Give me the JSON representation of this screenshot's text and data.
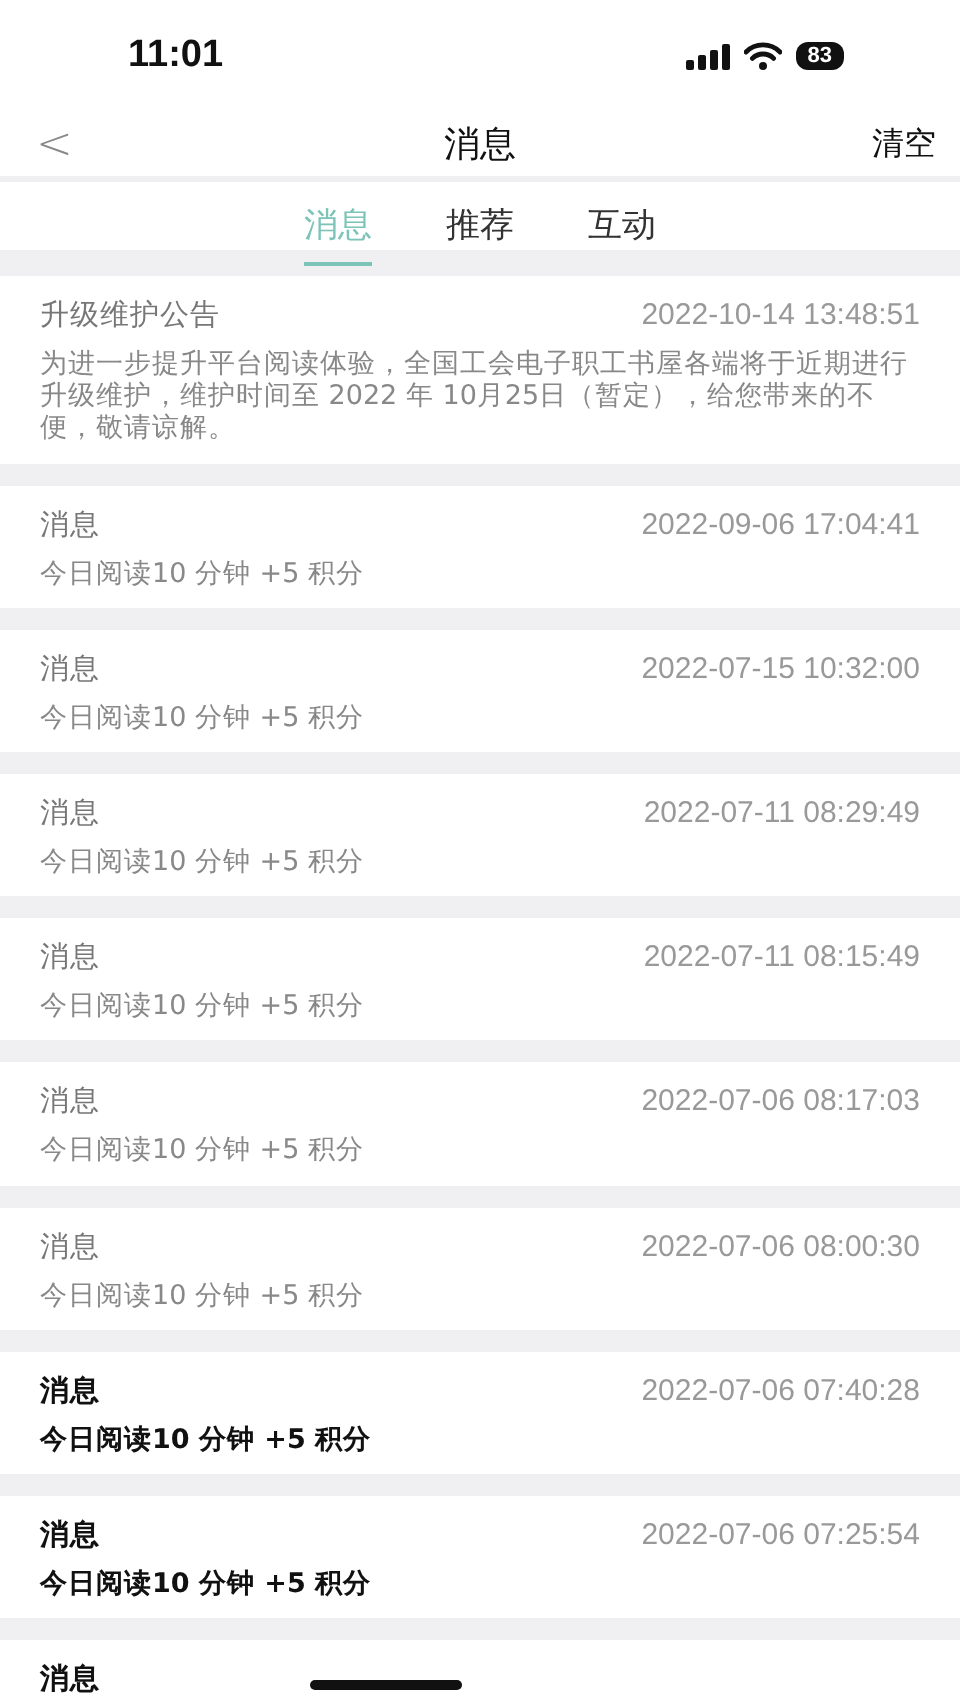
{
  "status_bar": {
    "time": "11:01",
    "battery": "83"
  },
  "nav": {
    "back": "<",
    "title": "消息",
    "action": "清空"
  },
  "tabs": [
    {
      "label": "消息",
      "selected": true
    },
    {
      "label": "推荐",
      "selected": false
    },
    {
      "label": "互动",
      "selected": false
    }
  ],
  "messages": [
    {
      "title": "升级维护公告",
      "time": "2022-10-14 13:48:51",
      "body": "为进一步提升平台阅读体验，全国工会电子职工书屋各端将于近期进行升级维护，维护时间至 2022 年 10月25日（暂定），给您带来的不便，敬请谅解。",
      "read": true
    },
    {
      "title": "消息",
      "time": "2022-09-06 17:04:41",
      "body": "今日阅读10 分钟 +5 积分",
      "read": true
    },
    {
      "title": "消息",
      "time": "2022-07-15 10:32:00",
      "body": "今日阅读10 分钟 +5 积分",
      "read": true
    },
    {
      "title": "消息",
      "time": "2022-07-11 08:29:49",
      "body": "今日阅读10 分钟 +5 积分",
      "read": true
    },
    {
      "title": "消息",
      "time": "2022-07-11 08:15:49",
      "body": "今日阅读10 分钟 +5 积分",
      "read": true
    },
    {
      "title": "消息",
      "time": "2022-07-06 08:17:03",
      "body": "今日阅读10 分钟 +5 积分",
      "read": true
    },
    {
      "title": "消息",
      "time": "2022-07-06 08:00:30",
      "body": "今日阅读10 分钟 +5 积分",
      "read": true
    },
    {
      "title": "消息",
      "time": "2022-07-06 07:40:28",
      "body": "今日阅读10 分钟 +5 积分",
      "read": false
    },
    {
      "title": "消息",
      "time": "2022-07-06 07:25:54",
      "body": "今日阅读10 分钟 +5 积分",
      "read": false
    },
    {
      "title": "消息",
      "read": false
    }
  ]
}
